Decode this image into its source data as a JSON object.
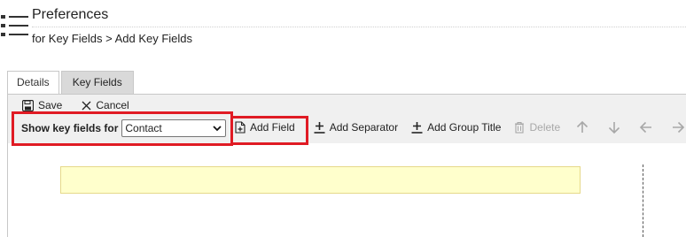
{
  "header": {
    "title": "Preferences",
    "breadcrumb": "for Key Fields > Add Key Fields",
    "icon": "list-menu-icon"
  },
  "tabs": [
    {
      "label": "Details",
      "active": false
    },
    {
      "label": "Key Fields",
      "active": true
    }
  ],
  "toolbar": {
    "save_label": "Save",
    "cancel_label": "Cancel",
    "show_key_fields_label": "Show key fields for",
    "show_key_fields_value": "Contact",
    "add_field_label": "Add Field",
    "add_separator_label": "Add Separator",
    "add_group_title_label": "Add Group Title",
    "delete_label": "Delete"
  },
  "colors": {
    "highlight": "#e01b24",
    "toolbar_bg": "#f0f0f0",
    "active_tab": "#d9d9d9",
    "placeholder_field": "#ffffcc",
    "disabled_text": "#a8a8a8"
  }
}
